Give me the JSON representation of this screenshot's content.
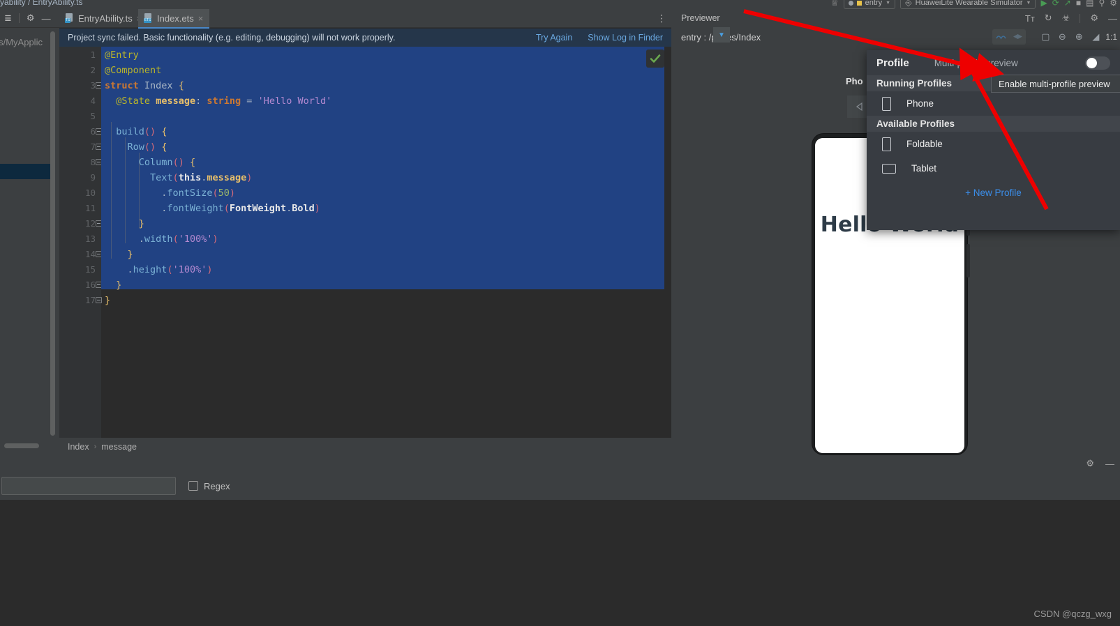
{
  "window": {
    "top_breadcrumb": "yability / EntryAbility.ts",
    "run_config": "entry",
    "device_target": "HuaweiLite Wearable Simulator"
  },
  "project_panel": {
    "path_label": "cts/MyApplic"
  },
  "tabs": [
    {
      "label": "EntryAbility.ts",
      "badge": "TS",
      "active": false,
      "close": "×"
    },
    {
      "label": "Index.ets",
      "badge": "ETS",
      "active": true,
      "close": "×"
    }
  ],
  "banner": {
    "message": "Project sync failed. Basic functionality (e.g. editing, debugging) will not work properly.",
    "try_again": "Try Again",
    "show_log": "Show Log in Finder"
  },
  "editor": {
    "line_numbers": [
      "1",
      "2",
      "3",
      "4",
      "5",
      "6",
      "7",
      "8",
      "9",
      "10",
      "11",
      "12",
      "13",
      "14",
      "15",
      "16",
      "17"
    ],
    "lines": [
      "@Entry",
      "@Component",
      "struct Index {",
      "  @State message: string = 'Hello World'",
      "",
      "  build() {",
      "    Row() {",
      "      Column() {",
      "        Text(this.message)",
      "          .fontSize(50)",
      "          .fontWeight(FontWeight.Bold)",
      "      }",
      "      .width('100%')",
      "    }",
      "    .height('100%')",
      "  }",
      "}"
    ],
    "inspection_status": "ok-check"
  },
  "breadcrumb": {
    "items": [
      "Index",
      "message"
    ],
    "separator": "›"
  },
  "find_panel": {
    "input_value": "",
    "regex_label": "Regex"
  },
  "previewer": {
    "title": "Previewer",
    "entry_path": "entry : /pages/Index",
    "zoom_ratio": "1:1",
    "device_label": "Pho",
    "preview_text": "Hello World",
    "title_icons": [
      "text-size-icon",
      "refresh-icon",
      "inspector-icon",
      "settings-icon",
      "minimize-icon"
    ],
    "toolbar_icons": [
      "multi-device-icon",
      "layers-icon",
      "profile-grid-icon",
      "chevron-down-icon",
      "frame-icon",
      "zoom-out-icon",
      "zoom-in-icon",
      "fit-icon"
    ]
  },
  "profile_popup": {
    "title": "Profile",
    "multi_profile_label": "Multi-profile preview",
    "toggle_on": false,
    "running_group": "Running Profiles",
    "available_group": "Available Profiles",
    "running_items": [
      {
        "label": "Phone",
        "icon": "phone-icon"
      }
    ],
    "available_items": [
      {
        "label": "Foldable",
        "icon": "phone-icon"
      },
      {
        "label": "Tablet",
        "icon": "tablet-icon"
      }
    ],
    "new_profile": "+ New Profile"
  },
  "tooltip": {
    "text": "Enable multi-profile preview"
  },
  "watermark": "CSDN @qczg_wxg",
  "colors": {
    "accent_blue": "#3b8eea",
    "selection_blue": "#214283",
    "banner_blue": "#25364a",
    "arrow_red": "#ee0000"
  }
}
